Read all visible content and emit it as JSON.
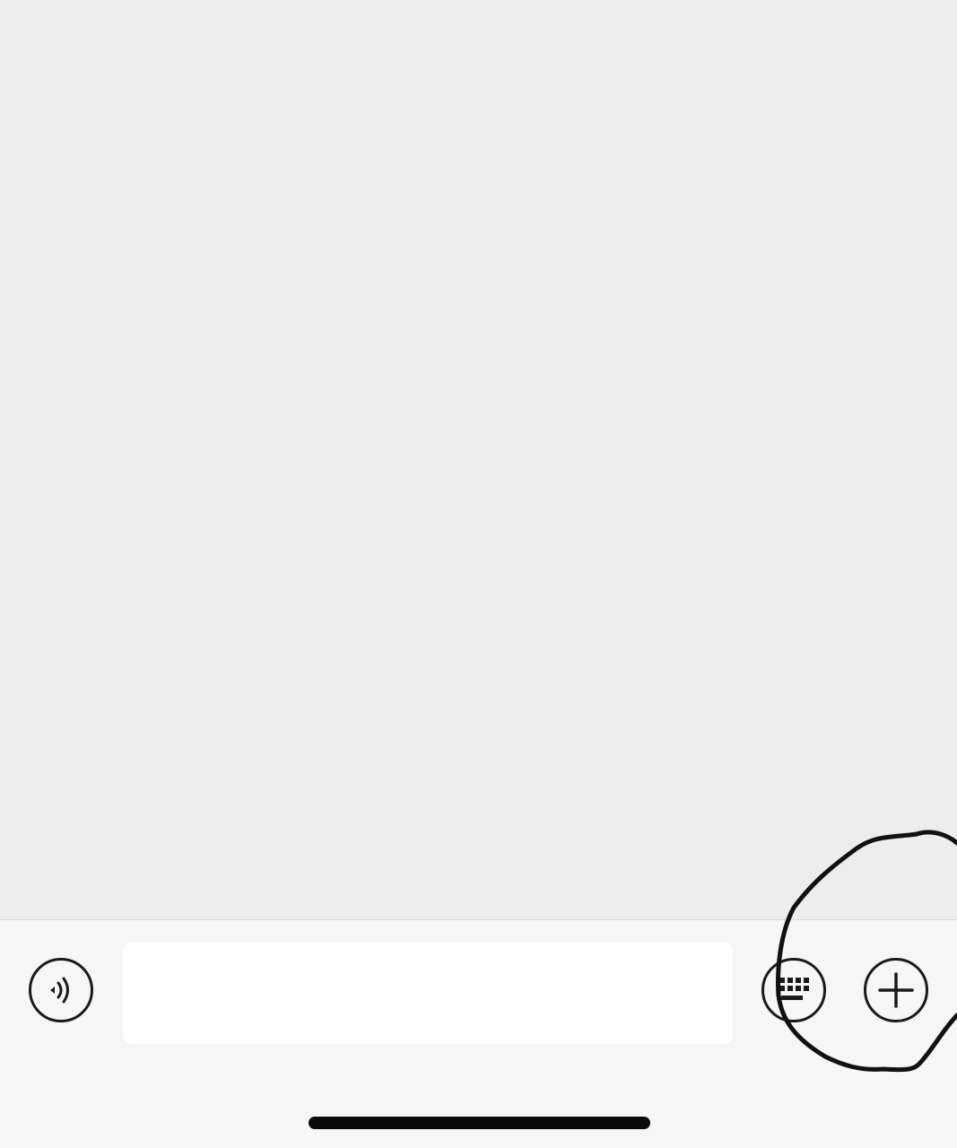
{
  "input_bar": {
    "voice_button": {
      "icon": "voice-icon"
    },
    "message_input": {
      "value": "",
      "placeholder": ""
    },
    "keyboard_button": {
      "icon": "keyboard-icon"
    },
    "more_button": {
      "icon": "plus-icon"
    }
  },
  "colors": {
    "chat_background": "#ededed",
    "input_bar_background": "#f6f6f6",
    "input_field": "#ffffff",
    "icon_stroke": "#1a1a1a",
    "annotation_stroke": "#000000"
  }
}
